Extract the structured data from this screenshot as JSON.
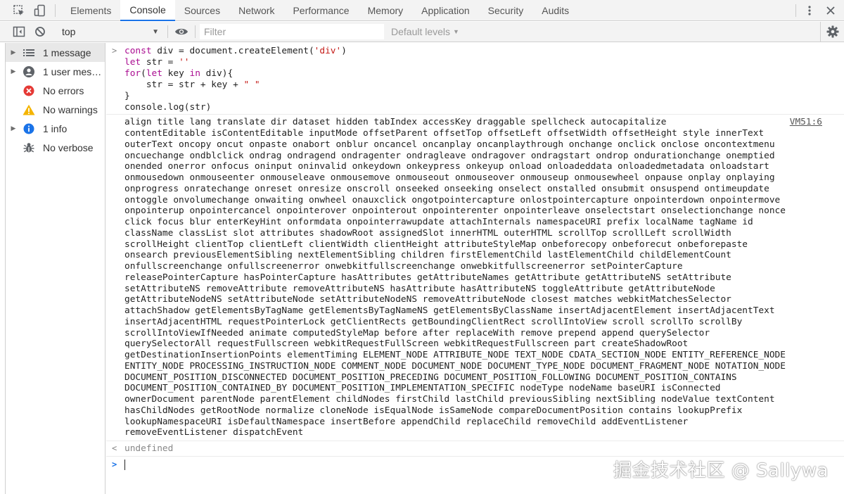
{
  "tabbar": {
    "tabs": [
      {
        "label": "Elements",
        "active": false
      },
      {
        "label": "Console",
        "active": true
      },
      {
        "label": "Sources",
        "active": false
      },
      {
        "label": "Network",
        "active": false
      },
      {
        "label": "Performance",
        "active": false
      },
      {
        "label": "Memory",
        "active": false
      },
      {
        "label": "Application",
        "active": false
      },
      {
        "label": "Security",
        "active": false
      },
      {
        "label": "Audits",
        "active": false
      }
    ],
    "icons": [
      "inspect-element-icon",
      "device-toolbar-icon",
      "more-options-icon",
      "close-icon"
    ]
  },
  "toolbar": {
    "context": "top",
    "filter_placeholder": "Filter",
    "levels_label": "Default levels",
    "icons": [
      "sidebar-toggle-icon",
      "clear-console-icon",
      "eye-icon",
      "settings-gear-icon"
    ]
  },
  "sidebar": {
    "items": [
      {
        "label": "1 message",
        "icon": "list-icon",
        "expandable": true,
        "selected": true
      },
      {
        "label": "1 user mes…",
        "icon": "user-icon",
        "expandable": true,
        "selected": false
      },
      {
        "label": "No errors",
        "icon": "error-icon",
        "expandable": false,
        "selected": false
      },
      {
        "label": "No warnings",
        "icon": "warning-icon",
        "expandable": false,
        "selected": false
      },
      {
        "label": "1 info",
        "icon": "info-icon",
        "expandable": true,
        "selected": false
      },
      {
        "label": "No verbose",
        "icon": "bug-icon",
        "expandable": false,
        "selected": false
      }
    ]
  },
  "colors": {
    "accent": "#1a73e8",
    "error": "#d93025",
    "warning": "#f4b400",
    "info": "#1a73e8",
    "keyword": "#aa0d91",
    "string": "#c41a16"
  },
  "console": {
    "code": {
      "l1_a": "const ",
      "l1_b": "div = document.createElement(",
      "l1_c": "'div'",
      "l1_d": ")",
      "l2_a": "let ",
      "l2_b": "str = ",
      "l2_c": "''",
      "l3_a": "for",
      "l3_b": "(",
      "l3_c": "let ",
      "l3_d": "key ",
      "l3_e": "in ",
      "l3_f": "div){",
      "l4_a": "    str = str + key + ",
      "l4_b": "\" \"",
      "l5": "}",
      "l6": "console.log(str)"
    },
    "source_link": "VM51:6",
    "log_lines": [
      "align title lang translate dir dataset hidden tabIndex accessKey draggable spellcheck autocapitalize",
      "contentEditable isContentEditable inputMode offsetParent offsetTop offsetLeft offsetWidth offsetHeight style innerText",
      "outerText oncopy oncut onpaste onabort onblur oncancel oncanplay oncanplaythrough onchange onclick onclose oncontextmenu",
      "oncuechange ondblclick ondrag ondragend ondragenter ondragleave ondragover ondragstart ondrop ondurationchange onemptied",
      "onended onerror onfocus oninput oninvalid onkeydown onkeypress onkeyup onload onloadeddata onloadedmetadata onloadstart",
      "onmousedown onmouseenter onmouseleave onmousemove onmouseout onmouseover onmouseup onmousewheel onpause onplay onplaying",
      "onprogress onratechange onreset onresize onscroll onseeked onseeking onselect onstalled onsubmit onsuspend ontimeupdate",
      "ontoggle onvolumechange onwaiting onwheel onauxclick ongotpointercapture onlostpointercapture onpointerdown onpointermove",
      "onpointerup onpointercancel onpointerover onpointerout onpointerenter onpointerleave onselectstart onselectionchange nonce",
      "click focus blur enterKeyHint onformdata onpointerrawupdate attachInternals namespaceURI prefix localName tagName id",
      "className classList slot attributes shadowRoot assignedSlot innerHTML outerHTML scrollTop scrollLeft scrollWidth",
      "scrollHeight clientTop clientLeft clientWidth clientHeight attributeStyleMap onbeforecopy onbeforecut onbeforepaste",
      "onsearch previousElementSibling nextElementSibling children firstElementChild lastElementChild childElementCount",
      "onfullscreenchange onfullscreenerror onwebkitfullscreenchange onwebkitfullscreenerror setPointerCapture",
      "releasePointerCapture hasPointerCapture hasAttributes getAttributeNames getAttribute getAttributeNS setAttribute",
      "setAttributeNS removeAttribute removeAttributeNS hasAttribute hasAttributeNS toggleAttribute getAttributeNode",
      "getAttributeNodeNS setAttributeNode setAttributeNodeNS removeAttributeNode closest matches webkitMatchesSelector",
      "attachShadow getElementsByTagName getElementsByTagNameNS getElementsByClassName insertAdjacentElement insertAdjacentText",
      "insertAdjacentHTML requestPointerLock getClientRects getBoundingClientRect scrollIntoView scroll scrollTo scrollBy",
      "scrollIntoViewIfNeeded animate computedStyleMap before after replaceWith remove prepend append querySelector",
      "querySelectorAll requestFullscreen webkitRequestFullScreen webkitRequestFullscreen part createShadowRoot",
      "getDestinationInsertionPoints elementTiming ELEMENT_NODE ATTRIBUTE_NODE TEXT_NODE CDATA_SECTION_NODE ENTITY_REFERENCE_NODE",
      "ENTITY_NODE PROCESSING_INSTRUCTION_NODE COMMENT_NODE DOCUMENT_NODE DOCUMENT_TYPE_NODE DOCUMENT_FRAGMENT_NODE NOTATION_NODE",
      "DOCUMENT_POSITION_DISCONNECTED DOCUMENT_POSITION_PRECEDING DOCUMENT_POSITION_FOLLOWING DOCUMENT_POSITION_CONTAINS",
      "DOCUMENT_POSITION_CONTAINED_BY DOCUMENT_POSITION_IMPLEMENTATION_SPECIFIC nodeType nodeName baseURI isConnected",
      "ownerDocument parentNode parentElement childNodes firstChild lastChild previousSibling nextSibling nodeValue textContent",
      "hasChildNodes getRootNode normalize cloneNode isEqualNode isSameNode compareDocumentPosition contains lookupPrefix",
      "lookupNamespaceURI isDefaultNamespace insertBefore appendChild replaceChild removeChild addEventListener",
      "removeEventListener dispatchEvent"
    ],
    "result": "undefined",
    "input_value": ""
  },
  "watermark": "掘金技术社区 @ Sallywa"
}
